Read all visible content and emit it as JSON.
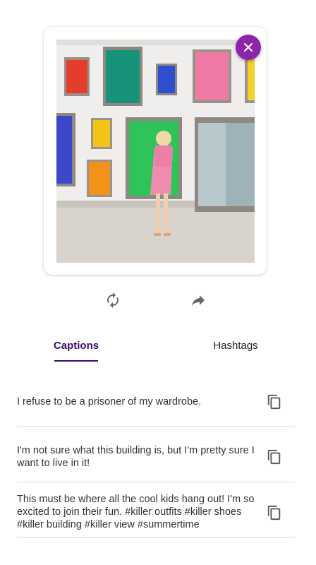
{
  "icons": {
    "close": "close-icon",
    "regenerate": "refresh-icon",
    "share": "share-icon",
    "copy": "copy-icon"
  },
  "colors": {
    "accent": "#8e24aa",
    "tab_active": "#3a0b6f",
    "divider": "#dcdcdc"
  },
  "tabs": [
    {
      "label": "Captions",
      "active": true
    },
    {
      "label": "Hashtags",
      "active": false
    }
  ],
  "captions": [
    {
      "text": "I refuse to be a prisoner of my wardrobe."
    },
    {
      "text": "I'm not sure what this building is, but I'm pretty sure I want to live in it!"
    },
    {
      "text": "This must be where all the cool kids hang out! I'm so excited to join their fun. #killer outfits #killer shoes #killer building #killer view #summertime"
    }
  ]
}
